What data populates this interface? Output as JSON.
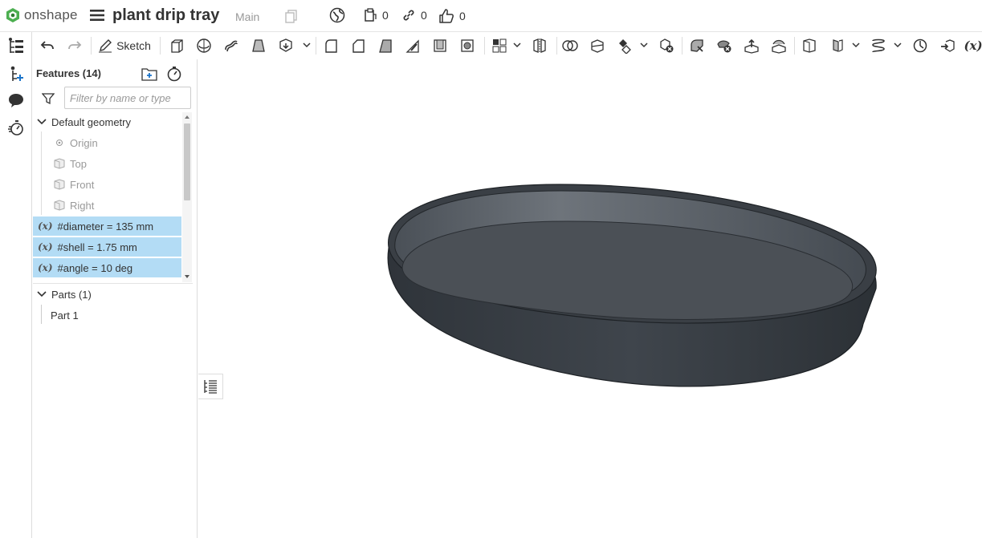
{
  "header": {
    "app_name": "onshape",
    "document_title": "plant drip tray",
    "branch": "Main",
    "stats": [
      {
        "icon": "copy-count-icon",
        "count": "0"
      },
      {
        "icon": "link-icon",
        "count": "0"
      },
      {
        "icon": "thumbs-up-icon",
        "count": "0"
      }
    ]
  },
  "toolbar": {
    "sketch_label": "Sketch"
  },
  "features": {
    "title": "Features (14)",
    "filter_placeholder": "Filter by name or type",
    "default_geometry": "Default geometry",
    "origin": "Origin",
    "planes": [
      "Top",
      "Front",
      "Right"
    ],
    "variables": [
      "#diameter = 135 mm",
      "#shell = 1.75 mm",
      "#angle = 10 deg"
    ],
    "variable_badge": "(x)"
  },
  "parts": {
    "title": "Parts (1)",
    "items": [
      "Part 1"
    ]
  },
  "colors": {
    "accent": "#2f8a3f",
    "selected_row": "#b3dcf5",
    "model_body": "#3c4147"
  }
}
